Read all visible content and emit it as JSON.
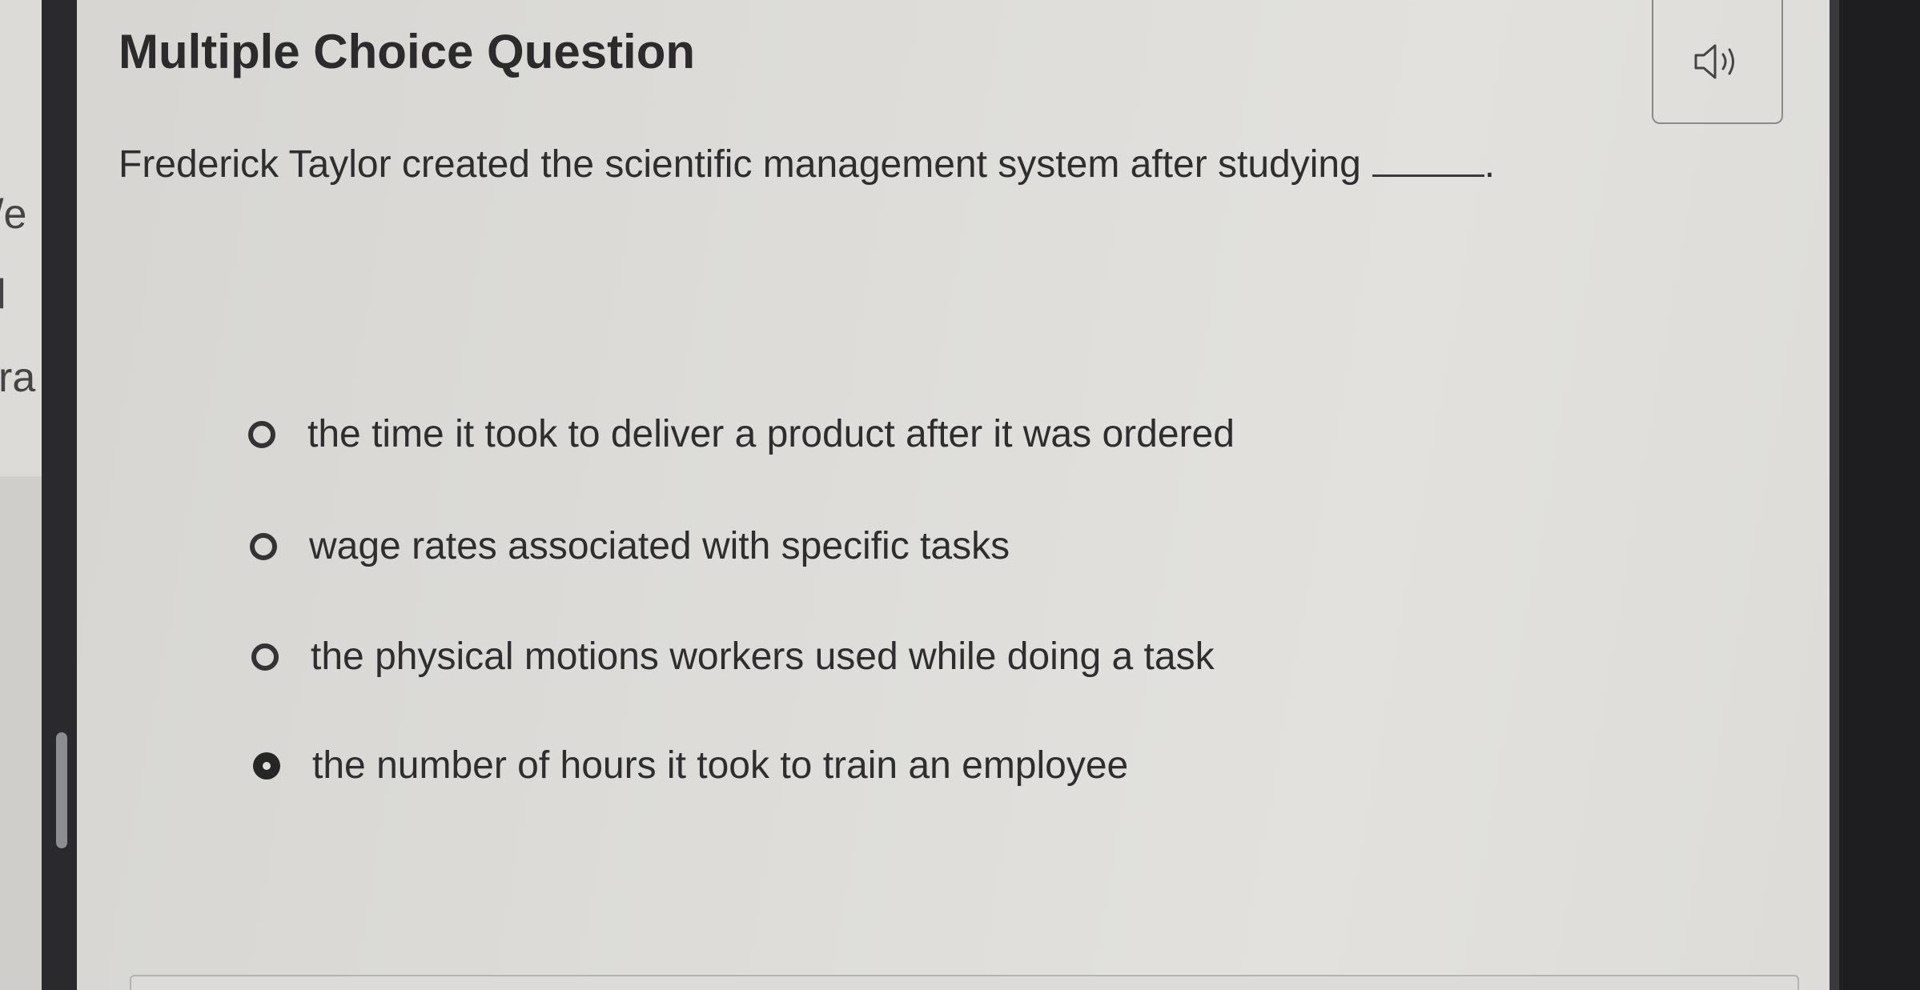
{
  "sidebar": {
    "fragments": [
      "/e",
      "l",
      "ra"
    ]
  },
  "question": {
    "heading": "Multiple Choice Question",
    "prompt": "Frederick Taylor created the scientific management system after studying",
    "prompt_end": ".",
    "audio_icon": "speaker-icon"
  },
  "options": [
    {
      "label": "the time it took to deliver a product after it was ordered",
      "selected": false
    },
    {
      "label": "wage rates associated with specific tasks",
      "selected": false
    },
    {
      "label": "the physical motions workers used while doing a task",
      "selected": false
    },
    {
      "label": "the number of hours it took to train an employee",
      "selected": true
    }
  ],
  "colors": {
    "text": "#2e2e2e",
    "radio_selected": "#262626",
    "background": "#dddcd8"
  }
}
